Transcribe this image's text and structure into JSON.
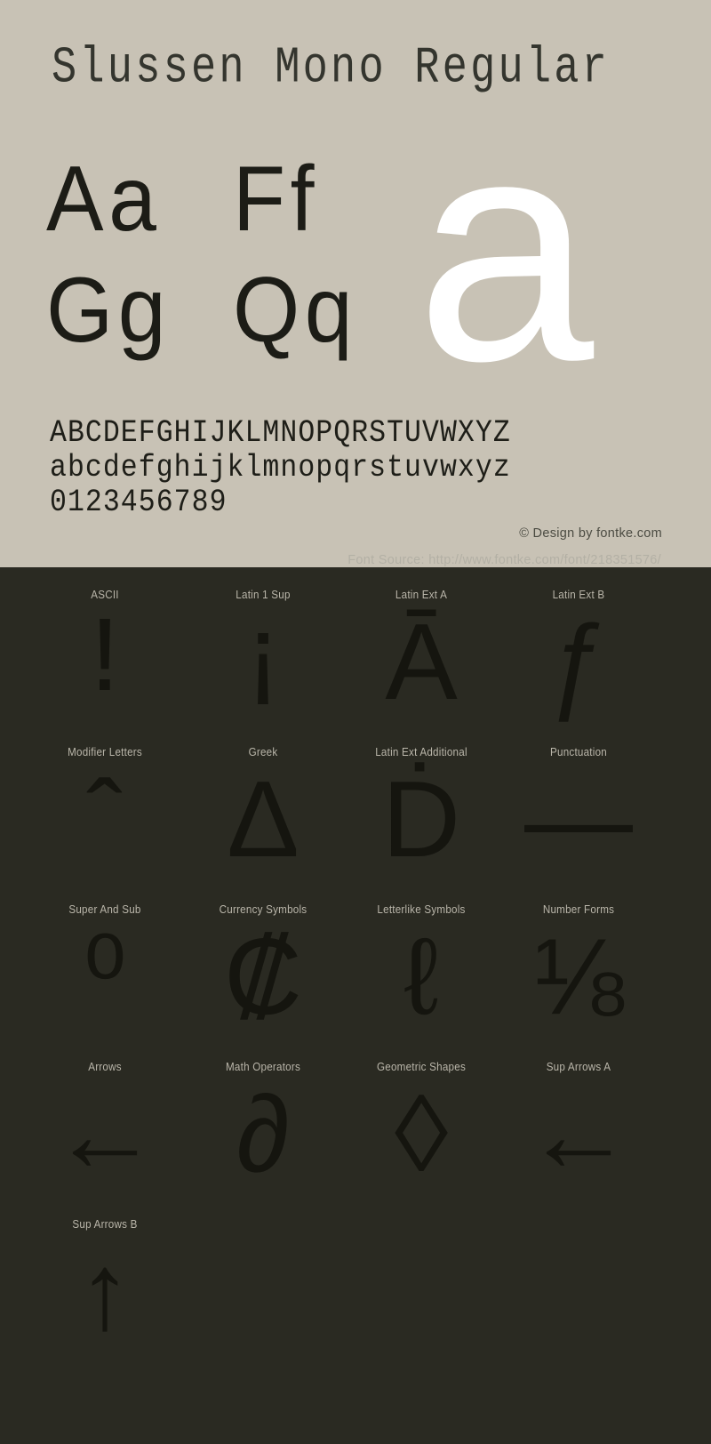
{
  "specimen": {
    "title": "Slussen Mono Regular",
    "sample_pairs": [
      [
        "Aa",
        "Ff"
      ],
      [
        "Gg",
        "Qq"
      ]
    ],
    "hero_glyph": "a",
    "alphabet_rows": [
      "ABCDEFGHIJKLMNOPQRSTUVWXYZ",
      "abcdefghijklmnopqrstuvwxyz",
      "0123456789"
    ],
    "copyright": "© Design by fontke.com",
    "background_color": "#c8c2b5",
    "text_color": "#1e1e18",
    "hero_color": "#ffffff"
  },
  "source": {
    "text": "Font Source: http://www.fontke.com/font/218351576/"
  },
  "blocks": {
    "background_color": "#2a2a22",
    "label_color": "#bab6aa",
    "glyph_color": "#15150f",
    "rows": [
      [
        {
          "label": "ASCII",
          "glyph": "!"
        },
        {
          "label": "Latin 1 Sup",
          "glyph": "¡"
        },
        {
          "label": "Latin Ext A",
          "glyph": "Ā"
        },
        {
          "label": "Latin Ext B",
          "glyph": "ƒ"
        }
      ],
      [
        {
          "label": "Modifier Letters",
          "glyph": "ˆ"
        },
        {
          "label": "Greek",
          "glyph": "Δ"
        },
        {
          "label": "Latin Ext Additional",
          "glyph": "Ḋ"
        },
        {
          "label": "Punctuation",
          "glyph": "—"
        }
      ],
      [
        {
          "label": "Super And Sub",
          "glyph": "⁰"
        },
        {
          "label": "Currency Symbols",
          "glyph": "₡"
        },
        {
          "label": "Letterlike Symbols",
          "glyph": "ℓ"
        },
        {
          "label": "Number Forms",
          "glyph": "⅛"
        }
      ],
      [
        {
          "label": "Arrows",
          "glyph": "←"
        },
        {
          "label": "Math Operators",
          "glyph": "∂"
        },
        {
          "label": "Geometric Shapes",
          "glyph": "◊"
        },
        {
          "label": "Sup Arrows A",
          "glyph": "←"
        }
      ],
      [
        {
          "label": "Sup Arrows B",
          "glyph": "↑"
        }
      ]
    ]
  }
}
